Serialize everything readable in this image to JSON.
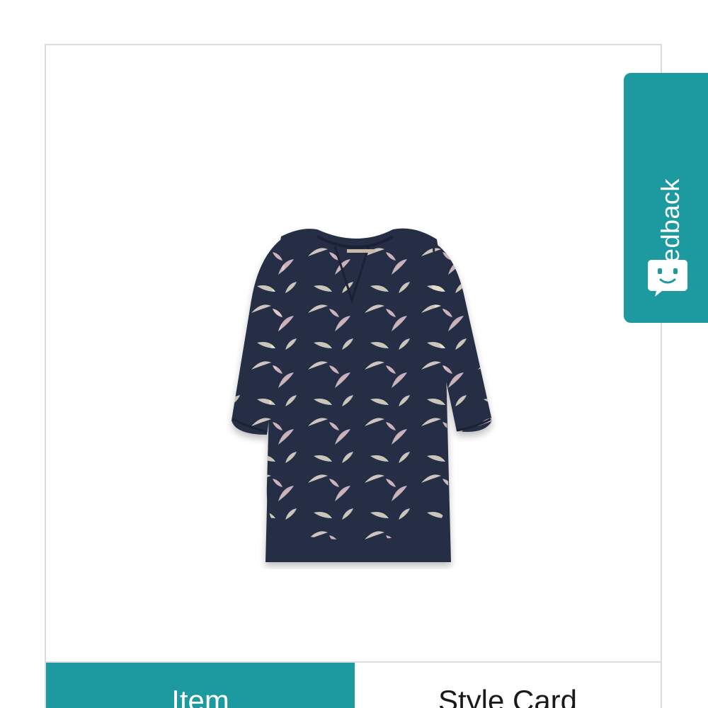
{
  "tabs": [
    {
      "label": "Item",
      "active": true
    },
    {
      "label": "Style Card",
      "active": false
    }
  ],
  "feedback": {
    "label": "Feedback",
    "icon": "smiley-chat-icon"
  },
  "colors": {
    "accent": "#1c9aa0",
    "border": "#dcdcdc",
    "garment": "#262d45",
    "pattern_light": "#e9e1cf",
    "pattern_pink": "#e7c8cf"
  },
  "product": {
    "image_icon": "printed-blouse-image"
  }
}
